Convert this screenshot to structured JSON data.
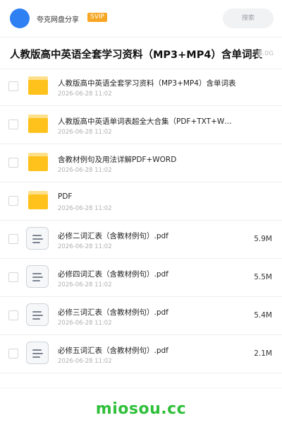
{
  "header": {
    "site_name": "夸克网盘分享",
    "badge": "SVIP",
    "search_placeholder": "搜索"
  },
  "share": {
    "title": "人教版高中英语全套学习资料（MP3+MP4）含单词表",
    "total_size": "3.0G"
  },
  "files": [
    {
      "type": "folder",
      "name": "人教版高中英语全套学习资料（MP3+MP4）含单词表",
      "date": "2026-06-28 11:02",
      "size": ""
    },
    {
      "type": "folder",
      "name": "人教版高中英语单词表超全大合集（PDF+TXT+W…",
      "date": "2026-06-28 11:02",
      "size": ""
    },
    {
      "type": "folder",
      "name": "含教材例句及用法详解PDF+WORD",
      "date": "2026-06-28 11:02",
      "size": ""
    },
    {
      "type": "folder",
      "name": "PDF",
      "date": "2026-06-28 11:02",
      "size": ""
    },
    {
      "type": "pdf",
      "name": "必修二词汇表（含教材例句）.pdf",
      "date": "2026-06-28 11:02",
      "size": "5.9M"
    },
    {
      "type": "pdf",
      "name": "必修四词汇表（含教材例句）.pdf",
      "date": "2026-06-28 11:02",
      "size": "5.5M"
    },
    {
      "type": "pdf",
      "name": "必修三词汇表（含教材例句）.pdf",
      "date": "2026-06-28 11:02",
      "size": "5.4M"
    },
    {
      "type": "pdf",
      "name": "必修五词汇表（含教材例句）.pdf",
      "date": "2026-06-28 11:02",
      "size": "2.1M"
    }
  ],
  "footer": {
    "watermark": "miosou.cc"
  },
  "colors": {
    "accent": "#2f80f3",
    "svip": "#f6a623",
    "folder": "#ffc21c",
    "watermark": "#2fbf3a"
  }
}
